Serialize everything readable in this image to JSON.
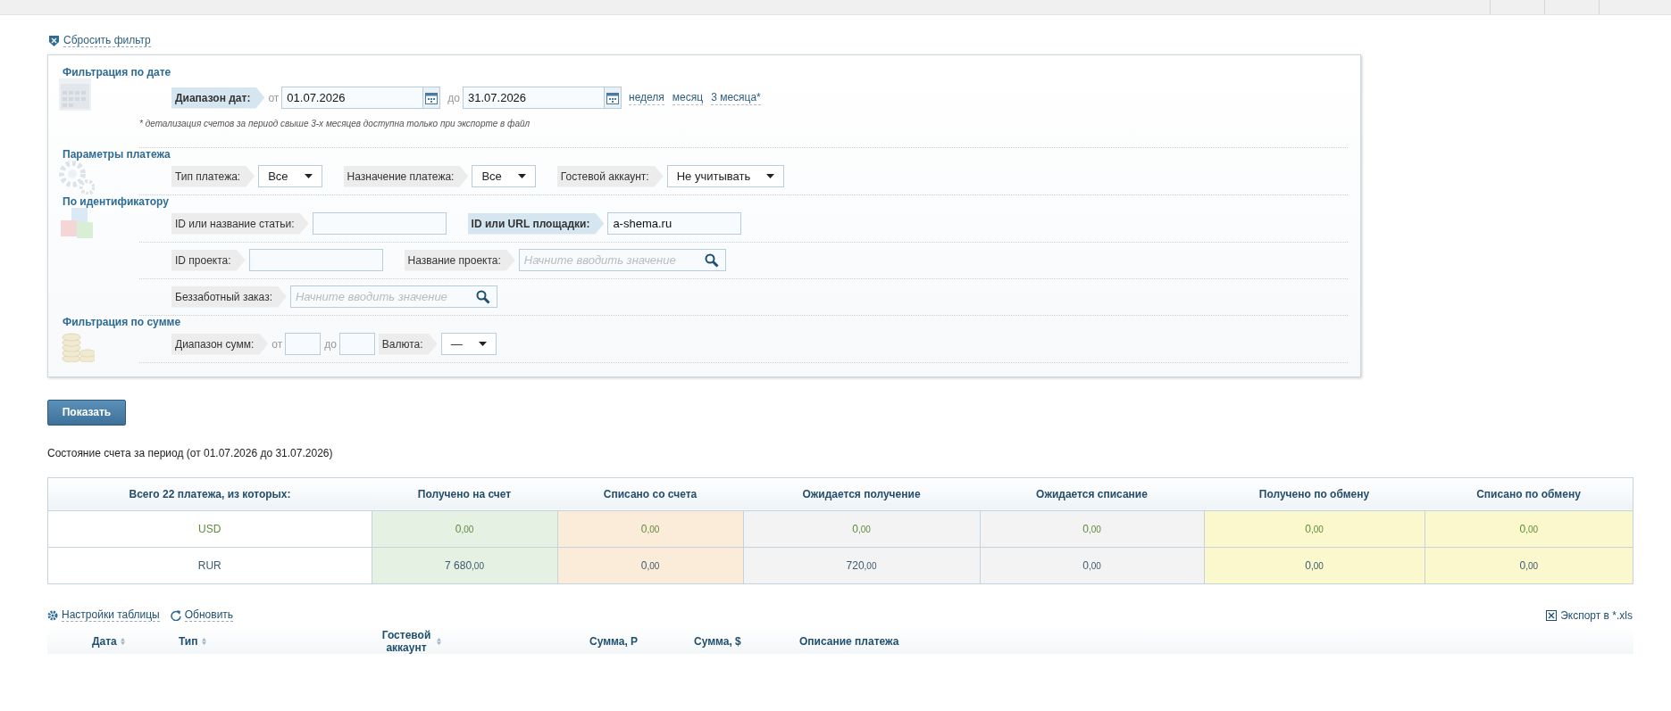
{
  "reset_filter": "Сбросить фильтр",
  "filter_sections": [
    {
      "title": "Фильтрация по дате",
      "rows": [
        [
          {
            "kind": "label",
            "text": "Диапазон дат:",
            "highlighted": true
          },
          {
            "kind": "word",
            "text": "от"
          },
          {
            "kind": "date",
            "value": "01.07.2026"
          },
          {
            "kind": "word",
            "text": "до"
          },
          {
            "kind": "date",
            "value": "31.07.2026"
          },
          {
            "kind": "link",
            "text": "неделя"
          },
          {
            "kind": "link",
            "text": "месяц"
          },
          {
            "kind": "link",
            "text": "3 месяца*"
          }
        ],
        [
          {
            "kind": "note",
            "text": "* детализация счетов за период свыше 3-х месяцев доступна только при экспорте в файл"
          }
        ]
      ]
    },
    {
      "title": "Параметры платежа",
      "rows": [
        [
          {
            "kind": "label",
            "text": "Тип платежа:",
            "highlighted": false
          },
          {
            "kind": "select",
            "value": "Все"
          },
          {
            "kind": "label",
            "text": "Назначение платежа:",
            "highlighted": false
          },
          {
            "kind": "select",
            "value": "Все"
          },
          {
            "kind": "label",
            "text": "Гостевой аккаунт:",
            "highlighted": false
          },
          {
            "kind": "select",
            "value": "Не учитывать"
          }
        ]
      ]
    },
    {
      "title": "По идентификатору",
      "rows": [
        [
          {
            "kind": "label",
            "text": "ID или название статьи:",
            "highlighted": false
          },
          {
            "kind": "input"
          },
          {
            "kind": "label",
            "text": "ID или URL площадки:",
            "highlighted": true
          },
          {
            "kind": "input",
            "value": "a-shema.ru"
          }
        ],
        [
          {
            "kind": "label",
            "text": "ID проекта:",
            "highlighted": false
          },
          {
            "kind": "input"
          },
          {
            "kind": "label",
            "text": "Название проекта:",
            "highlighted": false
          },
          {
            "kind": "search",
            "placeholder": "Начните вводить значение"
          }
        ],
        [
          {
            "kind": "label",
            "text": "Беззаботный заказ:",
            "highlighted": false
          },
          {
            "kind": "search",
            "placeholder": "Начните вводить значение"
          }
        ]
      ]
    },
    {
      "title": "Фильтрация по сумме",
      "rows": [
        [
          {
            "kind": "label",
            "text": "Диапазон сумм:",
            "highlighted": false
          },
          {
            "kind": "word",
            "text": "от"
          },
          {
            "kind": "small_input"
          },
          {
            "kind": "word",
            "text": "до"
          },
          {
            "kind": "small_input"
          },
          {
            "kind": "label",
            "text": "Валюта:",
            "highlighted": false
          },
          {
            "kind": "select",
            "value": "—"
          }
        ]
      ]
    }
  ],
  "show_button": "Показать",
  "period_text": "Состояние счета за период (от 01.07.2026 до 31.07.2026)",
  "summary": {
    "columns": [
      {
        "label": "Всего 22 платежа, из которых:"
      },
      {
        "label": "Получено на счет",
        "color": "#e5f1e3"
      },
      {
        "label": "Списано со счета",
        "color": "#faecd9"
      },
      {
        "label": "Ожидается получение",
        "color": "#f3f3f3"
      },
      {
        "label": "Ожидается списание",
        "color": "#f3f3f3"
      },
      {
        "label": "Получено по обмену",
        "color": "#faf8cc"
      },
      {
        "label": "Списано по обмену",
        "color": "#faf8cc"
      }
    ],
    "rows": [
      {
        "color": "#5d8a3c",
        "cells": [
          "USD",
          "0,00",
          "0,00",
          "0,00",
          "0,00",
          "0,00",
          "0,00"
        ]
      },
      {
        "color": "#3d5a70",
        "cells": [
          "RUR",
          "7 680,00",
          "0,00",
          "720,00",
          "0,00",
          "0,00",
          "0,00"
        ]
      }
    ]
  },
  "toolbar": {
    "settings": "Настройки таблицы",
    "refresh": "Обновить",
    "export": "Экспорт в *.xls"
  },
  "payments_table": {
    "columns": [
      {
        "label": "Дата",
        "sortable": true
      },
      {
        "label": "Тип",
        "sortable": true
      },
      {
        "label": "Гостевой аккаунт",
        "sortable": true
      },
      {
        "label": "Сумма, Р",
        "sortable": false
      },
      {
        "label": "Сумма, $",
        "sortable": false
      },
      {
        "label": "Описание платежа",
        "sortable": false
      }
    ]
  }
}
